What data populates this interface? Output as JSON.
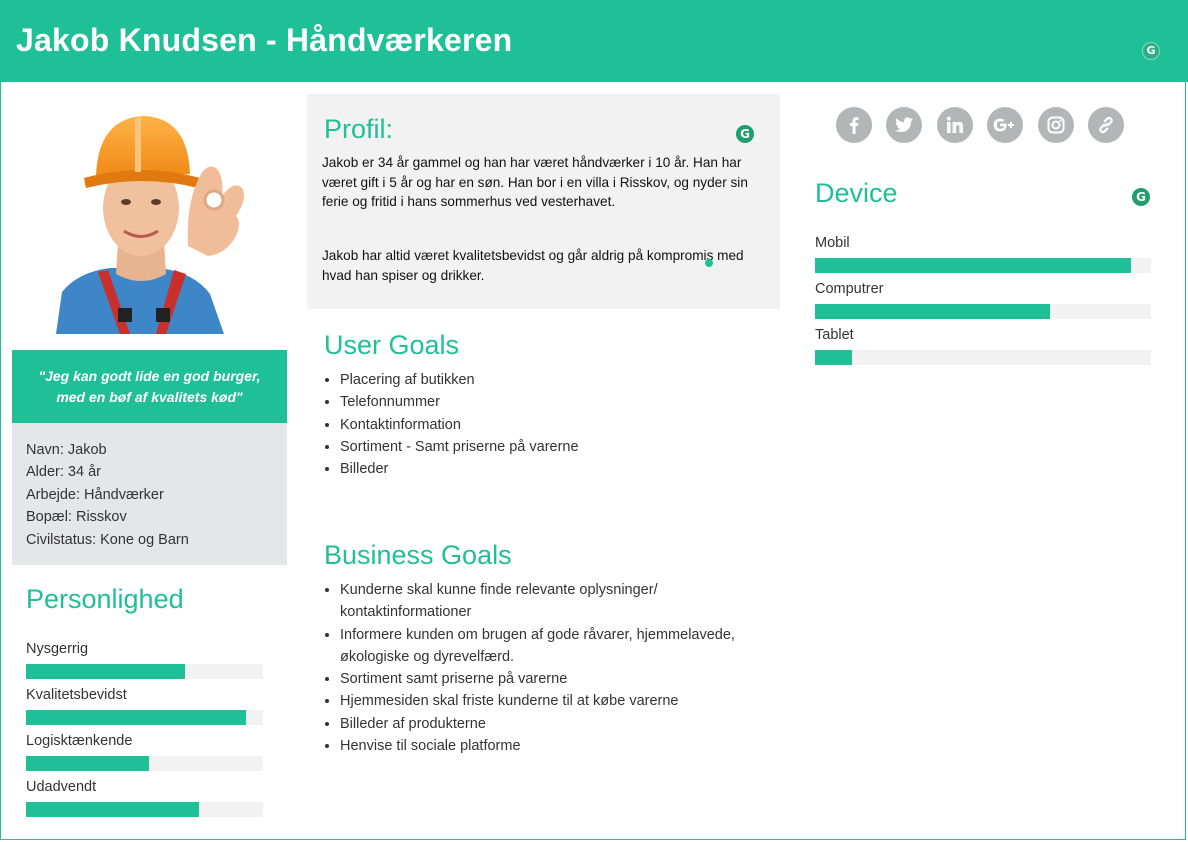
{
  "header": {
    "title": "Jakob Knudsen - Håndværkeren"
  },
  "quote": "\"Jeg kan godt lide en god burger, med en bøf af kvalitets kød\"",
  "info": [
    "Navn: Jakob",
    "Alder: 34 år",
    "Arbejde: Håndværker",
    "Bopæl: Risskov",
    "Civilstatus: Kone og Barn"
  ],
  "personality": {
    "title": "Personlighed",
    "traits": [
      {
        "label": "Nysgerrig",
        "value": 0.67
      },
      {
        "label": "Kvalitetsbevidst",
        "value": 0.93
      },
      {
        "label": "Logisktænkende",
        "value": 0.52
      },
      {
        "label": "Udadvendt",
        "value": 0.73
      }
    ]
  },
  "profile": {
    "title": "Profil:",
    "paragraph1": "Jakob er 34 år gammel og han har været håndværker i 10 år. Han har været gift i 5 år og har en søn. Han bor i en villa i Risskov, og nyder sin ferie og fritid i hans sommerhus ved vesterhavet.",
    "paragraph2": "Jakob har altid været kvalitetsbevidst og går aldrig på kompromis med hvad han spiser og drikker."
  },
  "user_goals": {
    "title": "User Goals",
    "items": [
      "Placering af butikken",
      "Telefonnummer",
      "Kontaktinformation",
      "Sortiment - Samt priserne på varerne",
      "Billeder"
    ]
  },
  "business_goals": {
    "title": "Business Goals",
    "items": [
      "Kunderne skal kunne finde relevante oplysninger/ kontaktinformationer",
      "Informere kunden om brugen af gode råvarer, hjemmelavede, økologiske og dyrevelfærd.",
      "Sortiment samt priserne på varerne",
      "Hjemmesiden skal friste kunderne til at købe varerne",
      "Billeder af produkterne",
      "Henvise til sociale platforme"
    ]
  },
  "social_icons": [
    "facebook-icon",
    "twitter-icon",
    "linkedin-icon",
    "google-plus-icon",
    "instagram-icon",
    "link-icon"
  ],
  "device": {
    "title": "Device",
    "items": [
      {
        "label": "Mobil",
        "value": 0.94
      },
      {
        "label": "Computrer",
        "value": 0.7
      },
      {
        "label": "Tablet",
        "value": 0.11
      }
    ]
  },
  "grammarly_badge": "G",
  "colors": {
    "accent": "#1fbf98",
    "panel": "#e5e6e8",
    "profile_bg": "#f2f2f2",
    "social": "#b3b5b7"
  }
}
